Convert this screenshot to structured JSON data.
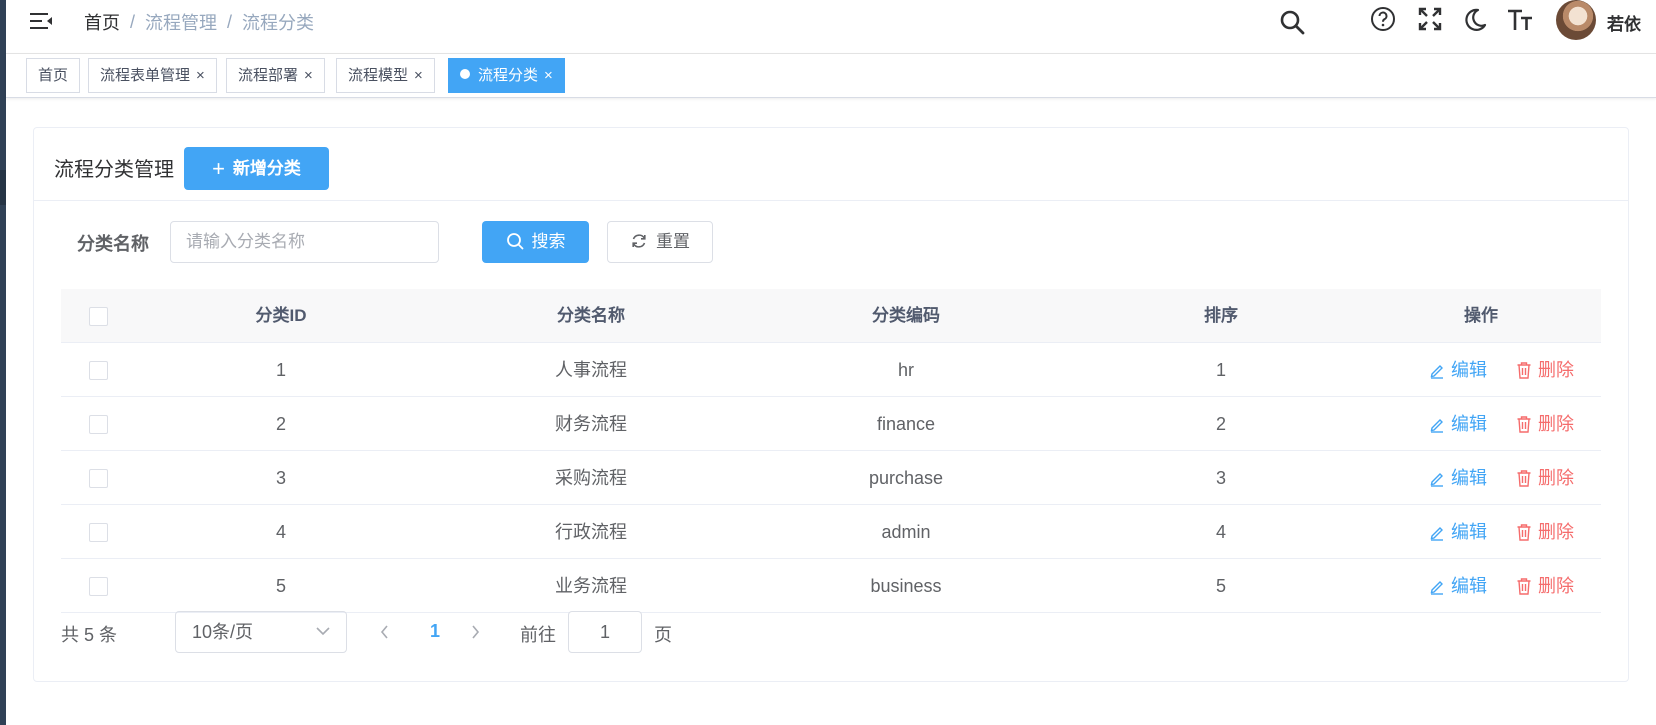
{
  "breadcrumb": {
    "home": "首页",
    "sep": "/",
    "items": [
      "流程管理",
      "流程分类"
    ]
  },
  "user": {
    "name": "若依"
  },
  "tags": [
    {
      "label": "首页",
      "closable": false,
      "active": false
    },
    {
      "label": "流程表单管理",
      "closable": true,
      "active": false
    },
    {
      "label": "流程部署",
      "closable": true,
      "active": false
    },
    {
      "label": "流程模型",
      "closable": true,
      "active": false
    },
    {
      "label": "流程分类",
      "closable": true,
      "active": true
    }
  ],
  "tag_close_glyph": "×",
  "card": {
    "title": "流程分类管理",
    "add_button": "新增分类",
    "add_icon": "+"
  },
  "search": {
    "label": "分类名称",
    "placeholder": "请输入分类名称",
    "value": "",
    "search_button": "搜索",
    "reset_button": "重置"
  },
  "table": {
    "columns": [
      "分类ID",
      "分类名称",
      "分类编码",
      "排序",
      "操作"
    ],
    "rows": [
      {
        "id": "1",
        "name": "人事流程",
        "code": "hr",
        "sort": "1"
      },
      {
        "id": "2",
        "name": "财务流程",
        "code": "finance",
        "sort": "2"
      },
      {
        "id": "3",
        "name": "采购流程",
        "code": "purchase",
        "sort": "3"
      },
      {
        "id": "4",
        "name": "行政流程",
        "code": "admin",
        "sort": "4"
      },
      {
        "id": "5",
        "name": "业务流程",
        "code": "business",
        "sort": "5"
      }
    ],
    "edit_label": "编辑",
    "delete_label": "删除"
  },
  "pagination": {
    "total_text": "共 5 条",
    "page_size": "10条/页",
    "current_page": "1",
    "goto_label": "前往",
    "goto_value": "1",
    "page_suffix": "页"
  },
  "colors": {
    "primary": "#42a5f5",
    "danger": "#f56c6c",
    "sidebar": "#304156"
  }
}
